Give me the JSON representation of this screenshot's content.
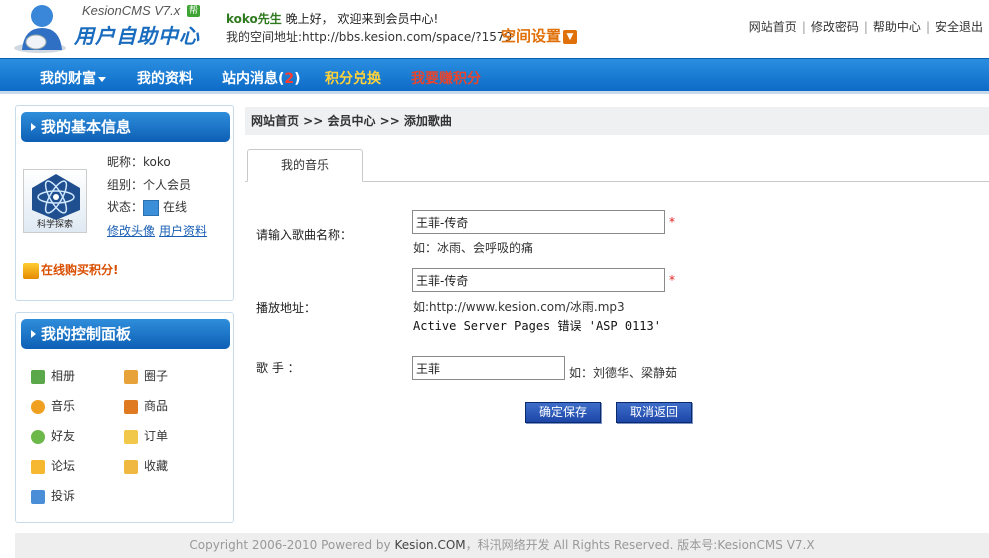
{
  "header": {
    "brand": "KesionCMS V7.x",
    "badge": "帮",
    "title": "用户自助中心",
    "username": "koko先生",
    "greeting": " 晚上好， 欢迎来到会员中心!",
    "space_label": "我的空间地址:",
    "space_url": "http://bbs.kesion.com/space/?1579",
    "space_settings": "空间设置",
    "top_links": [
      "网站首页",
      "修改密码",
      "帮助中心",
      "安全退出"
    ]
  },
  "nav": {
    "items": [
      "我的财富",
      "我的资料",
      "站内消息(",
      "积分兑换",
      "我要赚积分"
    ],
    "message_count": "2",
    "message_close": ")"
  },
  "info_box": {
    "title": "我的基本信息",
    "nickname": "昵称：koko",
    "group": "组别：个人会员",
    "status_label": "状态：",
    "status_value": "在线",
    "edit_avatar": "修改头像",
    "profile": "用户资料",
    "avatar_caption": "科学探索",
    "buy_points": "在线购买积分!"
  },
  "panel_box": {
    "title": "我的控制面板",
    "items": [
      "相册",
      "圈子",
      "音乐",
      "商品",
      "好友",
      "订单",
      "论坛",
      "收藏",
      "投诉"
    ]
  },
  "breadcrumb": "网站首页 >> 会员中心 >> 添加歌曲",
  "tab": "我的音乐",
  "form": {
    "song_label": "请输入歌曲名称：",
    "song_value": "王菲-传奇",
    "song_hint": "如：冰雨、会呼吸的痛",
    "url_label": "播放地址：",
    "url_value": "王菲-传奇",
    "url_hint": "如:http://www.kesion.com/冰雨.mp3",
    "error_text": "Active Server Pages 错误 'ASP 0113'",
    "singer_label": "歌  手 ：",
    "singer_value": "王菲",
    "singer_hint": "如：刘德华、梁静茹",
    "required_mark": "*",
    "save_button": "确定保存",
    "cancel_button": "取消返回"
  },
  "footer": {
    "text_before": "Copyright 2006-2010 Powered by ",
    "brand": "Kesion.COM",
    "text_after": "，科汛网络开发  All Rights Reserved. 版本号:KesionCMS V7.X"
  },
  "colors": {
    "nav_blue": "#1a7fd6",
    "accent_orange": "#e0700a",
    "link_blue": "#1a5fb4",
    "button_blue": "#2a56b6"
  }
}
